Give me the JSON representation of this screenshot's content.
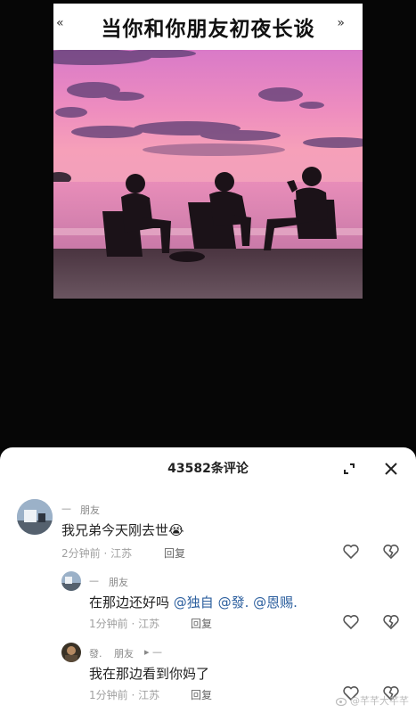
{
  "video": {
    "title_quote_left": "«",
    "title": "当你和你朋友初夜长谈",
    "title_quote_right": "»"
  },
  "comments_panel": {
    "count_label": "43582条评论"
  },
  "comments": [
    {
      "prefix": "—",
      "name": "朋友",
      "text": "我兄弟今天刚去世😭",
      "meta": "2分钟前 · 江苏",
      "reply_label": "回复"
    },
    {
      "prefix": "—",
      "name": "朋友",
      "text_plain": "在那边还好吗",
      "mentions": [
        "@独自",
        "@發.",
        "@恩赐."
      ],
      "meta": "1分钟前 · 江苏",
      "reply_label": "回复"
    },
    {
      "name_prefix": "發.",
      "name": "朋友",
      "arrow": "▸ —",
      "text": "我在那边看到你妈了",
      "meta": "1分钟前 · 江苏",
      "reply_label": "回复"
    }
  ],
  "watermark": "@芊芊大芊芊",
  "colors": {
    "sky_top": "#e47fc6",
    "sky_mid": "#f08fb8",
    "sea": "#e98fb6",
    "mention": "#2c5f9e"
  },
  "icons": [
    "expand-icon",
    "close-icon",
    "like-icon",
    "dislike-icon",
    "weibo-icon"
  ]
}
